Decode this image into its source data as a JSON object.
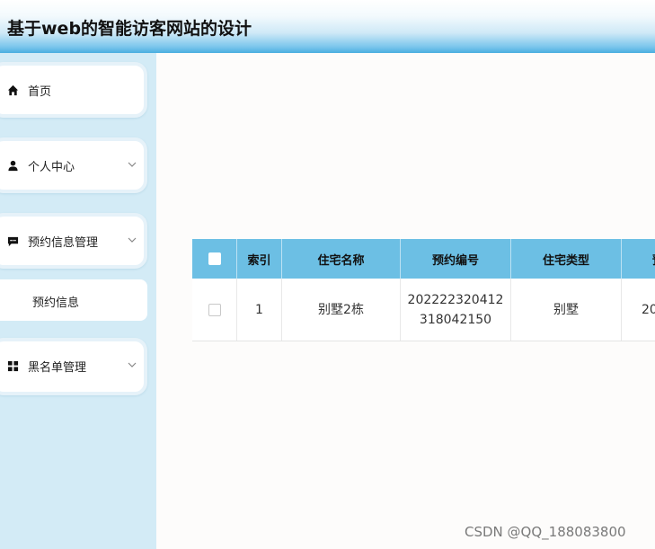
{
  "header": {
    "title": "基于web的智能访客网站的设计"
  },
  "sidebar": {
    "items": [
      {
        "label": "首页",
        "icon": "home-icon",
        "has_submenu": false
      },
      {
        "label": "个人中心",
        "icon": "user-icon",
        "has_submenu": true
      },
      {
        "label": "预约信息管理",
        "icon": "chat-icon",
        "has_submenu": true,
        "children": [
          {
            "label": "预约信息"
          }
        ]
      },
      {
        "label": "黑名单管理",
        "icon": "grid-icon",
        "has_submenu": true
      }
    ]
  },
  "table": {
    "columns": [
      "索引",
      "住宅名称",
      "预约编号",
      "住宅类型",
      "预"
    ],
    "rows": [
      {
        "index": "1",
        "name": "别墅2栋",
        "booking_no_line1": "202222320412",
        "booking_no_line2": "318042150",
        "type": "别墅",
        "partial": "20"
      }
    ]
  },
  "watermark": "CSDN @QQ_188083800",
  "colors": {
    "header_accent": "#4aaee0",
    "sidebar_bg": "#d3ebf6",
    "table_header_bg": "#6cbfe4"
  }
}
